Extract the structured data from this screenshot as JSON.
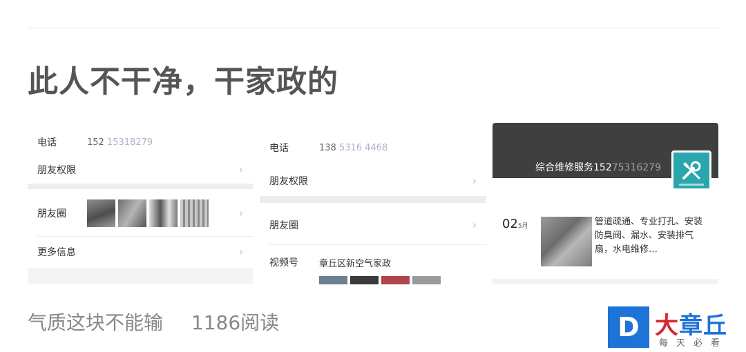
{
  "post": {
    "title": "此人不干净，干家政的",
    "author": "气质这块不能输",
    "reads": "1186阅读"
  },
  "screenshot1": {
    "phone_label": "电话",
    "phone_value": "152",
    "phone_blur": "15318279",
    "friend_perm": "朋友权限",
    "moments": "朋友圈",
    "more_info": "更多信息",
    "chevron": "›"
  },
  "screenshot2": {
    "phone_label": "电话",
    "phone_value": "138",
    "phone_blur": "5316 4468",
    "friend_perm": "朋友权限",
    "moments": "朋友圈",
    "channel_label": "视频号",
    "channel_value": "章丘区新空气家政",
    "chevron": "›"
  },
  "screenshot3": {
    "profile_title": "综合维修服务152",
    "profile_blur": "75316279",
    "date_day": "02",
    "date_month": "5月",
    "post_text": "管道疏通、专业打孔、安装防臭阀、漏水、安装排气扇，水电维修…",
    "logo_icon": "tools-icon"
  },
  "brand": {
    "badge": "D",
    "name_main": "大章丘",
    "name_red_char": "大",
    "name_rest": "章丘",
    "slogan": "每天必看"
  },
  "colors": {
    "brand_blue": "#1e73d6",
    "brand_red": "#d4282d",
    "logo_teal": "#2aa6ad"
  }
}
